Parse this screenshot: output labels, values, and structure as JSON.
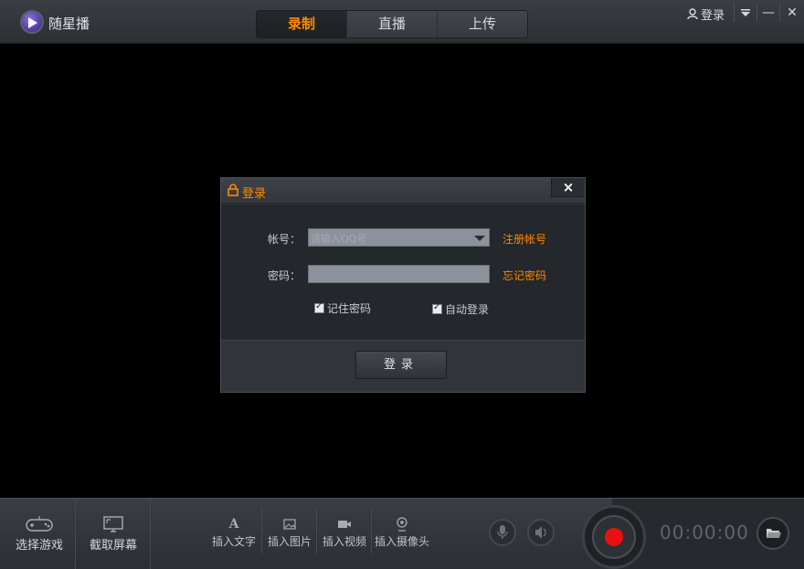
{
  "app": {
    "title": "随星播",
    "top_login": "登录"
  },
  "tabs": [
    {
      "label": "录制",
      "active": true
    },
    {
      "label": "直播",
      "active": false
    },
    {
      "label": "上传",
      "active": false
    }
  ],
  "window_controls": {
    "menu_icon": "dropdown-menu-icon",
    "minimize": "—",
    "close": "✕"
  },
  "dialog": {
    "title": "登录",
    "close": "×",
    "account_label": "帐号：",
    "account_placeholder": "请输入QQ号",
    "register_link": "注册帐号",
    "password_label": "密码：",
    "password_value": "",
    "forgot_link": "忘记密码",
    "remember_label": "记住密码",
    "remember_checked": true,
    "autologin_label": "自动登录",
    "autologin_checked": true,
    "login_button": "登录"
  },
  "bottom": {
    "select_game": "选择游戏",
    "capture_screen": "截取屏幕",
    "insert_text": "插入文字",
    "insert_image": "插入图片",
    "insert_video": "插入视频",
    "insert_camera": "插入摄像头",
    "timer": "00:00:00"
  },
  "colors": {
    "accent": "#ff8a00",
    "record": "#e81010"
  }
}
